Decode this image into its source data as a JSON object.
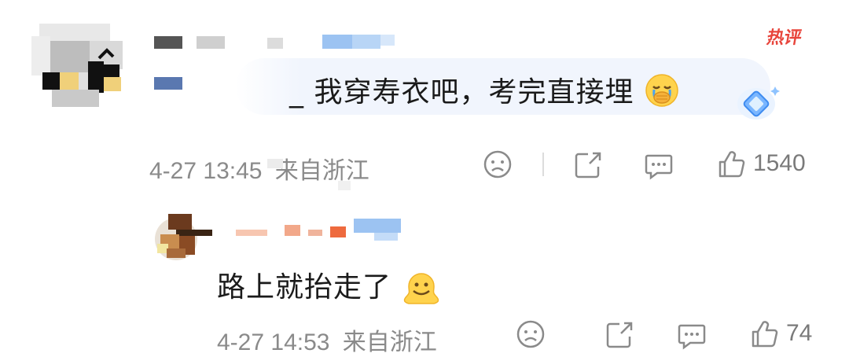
{
  "top_comment": {
    "text": "_ 我穿寿衣吧，考完直接埋",
    "emoji": "crying-face-covering-mouth-emoji",
    "badge_hot": "热评",
    "timestamp": "4-27 13:45",
    "location": "来自浙江",
    "like_count": "1540"
  },
  "reply": {
    "text": "路上就抬走了",
    "emoji": "melting-face-emoji",
    "timestamp": "4-27 14:53",
    "location": "来自浙江",
    "like_count": "74"
  },
  "colors": {
    "hot_badge": "#e8453c",
    "meta_text": "#8a8a8a",
    "bubble_bg": "#f1f5fd",
    "vip_blue": "#4f9bff"
  }
}
